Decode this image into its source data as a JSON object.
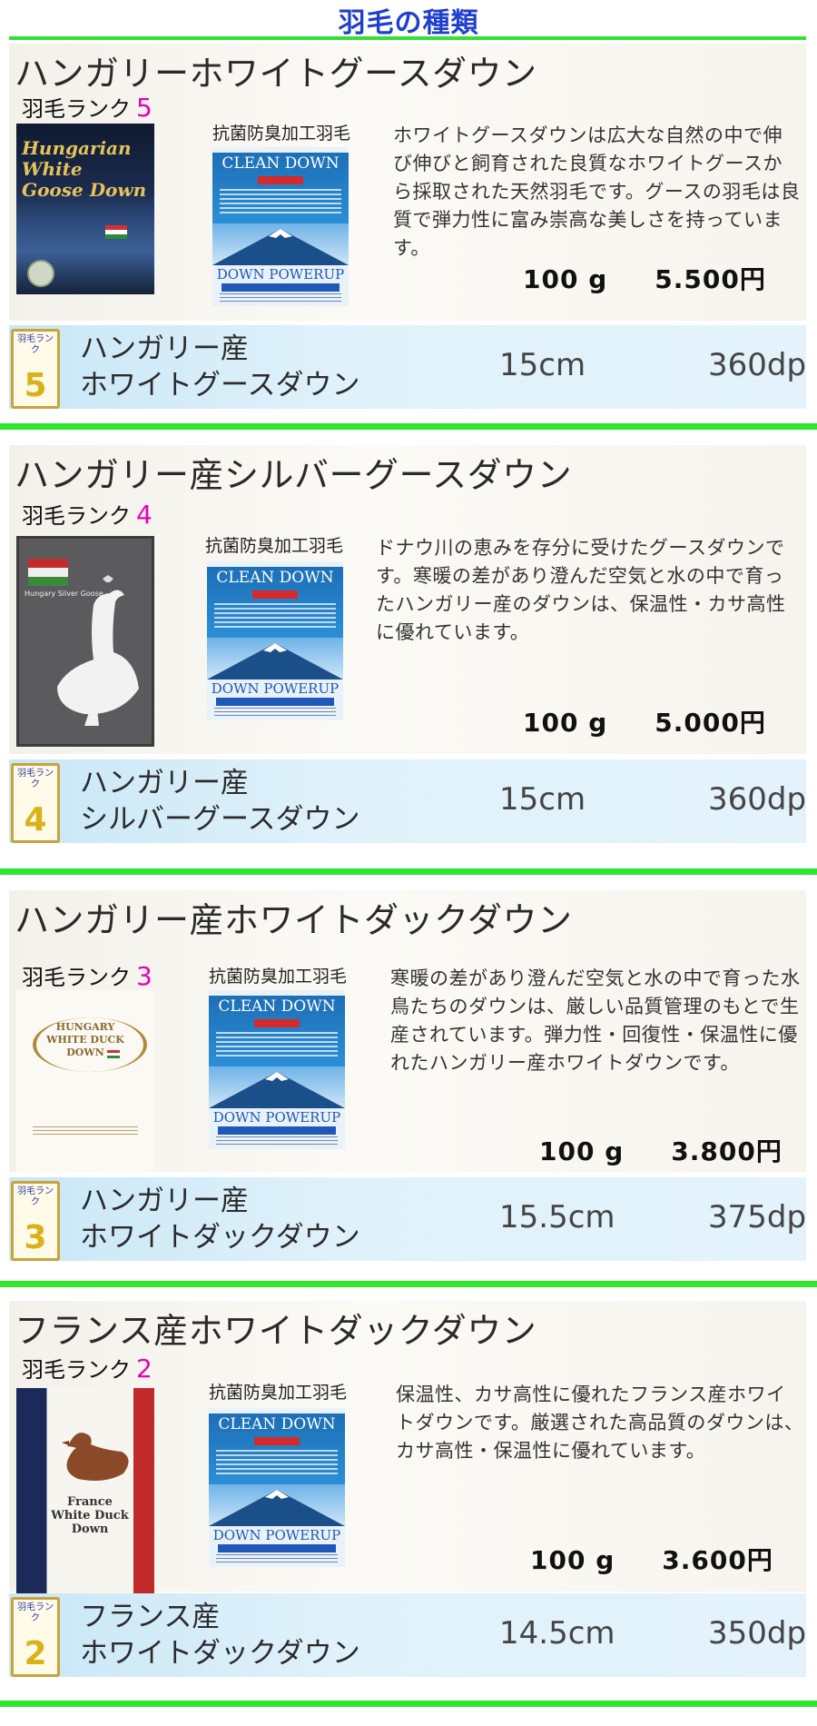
{
  "page_title": "羽毛の種類",
  "common": {
    "rank_label": "羽毛ランク",
    "cert_label": "抗菌防臭加工羽毛",
    "cert_card_top": "CLEAN DOWN",
    "cert_card_bottom": "DOWN POWERUP",
    "badge_text": "羽毛ランク",
    "price_weight": "100 g"
  },
  "products": [
    {
      "title": "ハンガリーホワイトグースダウン",
      "rank": "5",
      "image_title": "Hungarian White Goose Down",
      "description": "ホワイトグースダウンは広大な自然の中で伸び伸びと飼育された良質なホワイトグースから採取された天然羽毛です。グースの羽毛は良質で弾力性に富み崇高な美しさを持っています。",
      "price": "5.500円",
      "bar_name_line1": "ハンガリー産",
      "bar_name_line2": "ホワイトグースダウン",
      "length": "15cm",
      "dp": "360dp"
    },
    {
      "title": "ハンガリー産シルバーグースダウン",
      "rank": "4",
      "image_title": "Hungary Silver Goose",
      "description": "ドナウ川の恵みを存分に受けたグースダウンです。寒暖の差があり澄んだ空気と水の中で育ったハンガリー産のダウンは、保温性・カサ高性に優れています。",
      "price": "5.000円",
      "bar_name_line1": "ハンガリー産",
      "bar_name_line2": "シルバーグースダウン",
      "length": "15cm",
      "dp": "360dp"
    },
    {
      "title": "ハンガリー産ホワイトダックダウン",
      "rank": "3",
      "image_title": "HUNGARY WHITE DUCK DOWN",
      "description": "寒暖の差があり澄んだ空気と水の中で育った水鳥たちのダウンは、厳しい品質管理のもとで生産されています。弾力性・回復性・保温性に優れたハンガリー産ホワイトダウンです。",
      "price": "3.800円",
      "bar_name_line1": "ハンガリー産",
      "bar_name_line2": "ホワイトダックダウン",
      "length": "15.5cm",
      "dp": "375dp"
    },
    {
      "title": "フランス産ホワイトダックダウン",
      "rank": "2",
      "image_title": "France White Duck Down",
      "description": "保温性、カサ高性に優れたフランス産ホワイトダウンです。厳選された高品質のダウンは、カサ高性・保温性に優れています。",
      "price": "3.600円",
      "bar_name_line1": "フランス産",
      "bar_name_line2": "ホワイトダックダウン",
      "length": "14.5cm",
      "dp": "350dp"
    }
  ]
}
